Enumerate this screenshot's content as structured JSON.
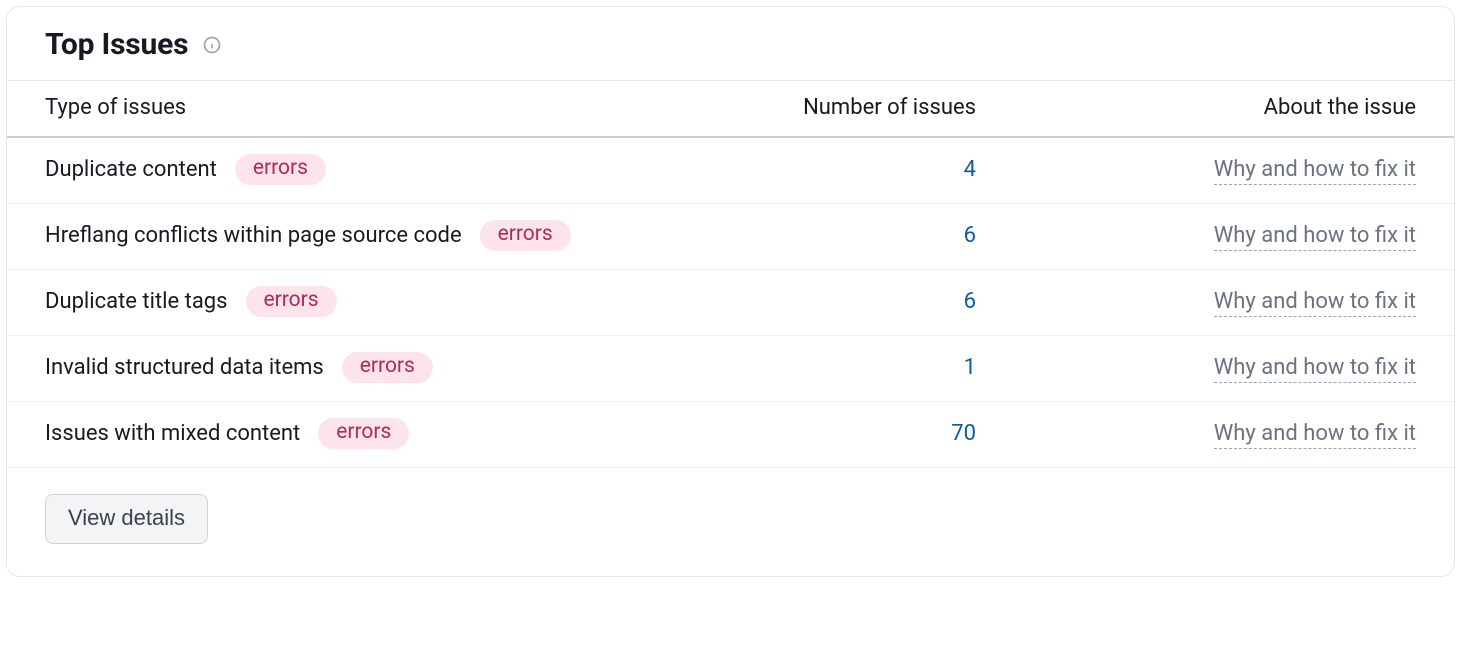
{
  "header": {
    "title": "Top Issues"
  },
  "table": {
    "columns": {
      "type": "Type of issues",
      "count": "Number of issues",
      "about": "About the issue"
    },
    "badge_label": "errors",
    "fix_link_label": "Why and how to fix it",
    "rows": [
      {
        "name": "Duplicate content",
        "count": "4"
      },
      {
        "name": "Hreflang conflicts within page source code",
        "count": "6"
      },
      {
        "name": "Duplicate title tags",
        "count": "6"
      },
      {
        "name": "Invalid structured data items",
        "count": "1"
      },
      {
        "name": "Issues with mixed content",
        "count": "70"
      }
    ]
  },
  "footer": {
    "view_details_label": "View details"
  }
}
